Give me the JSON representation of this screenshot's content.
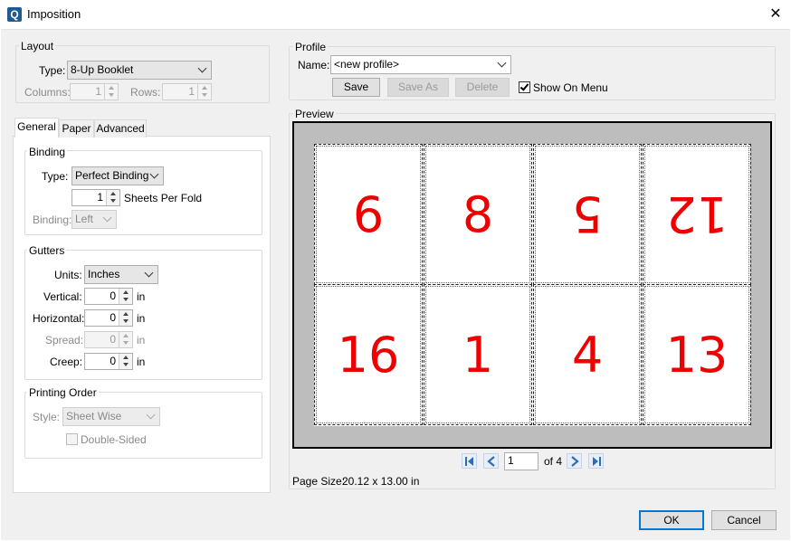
{
  "window": {
    "title": "Imposition",
    "app_icon_letter": "Q",
    "close_glyph": "✕"
  },
  "layout": {
    "legend": "Layout",
    "type_label": "Type:",
    "type_value": "8-Up Booklet",
    "columns_label": "Columns:",
    "columns_value": "1",
    "rows_label": "Rows:",
    "rows_value": "1"
  },
  "tabs": [
    {
      "label": "General",
      "active": true
    },
    {
      "label": "Paper",
      "active": false
    },
    {
      "label": "Advanced",
      "active": false
    }
  ],
  "binding": {
    "legend": "Binding",
    "type_label": "Type:",
    "type_value": "Perfect Binding",
    "sheets_value": "1",
    "sheets_label": "Sheets Per Fold",
    "binding_label": "Binding:",
    "binding_value": "Left"
  },
  "gutters": {
    "legend": "Gutters",
    "units_label": "Units:",
    "units_value": "Inches",
    "vertical_label": "Vertical:",
    "vertical_value": "0",
    "horizontal_label": "Horizontal:",
    "horizontal_value": "0",
    "spread_label": "Spread:",
    "spread_value": "0",
    "creep_label": "Creep:",
    "creep_value": "0",
    "unit_suffix": "in"
  },
  "printing_order": {
    "legend": "Printing Order",
    "style_label": "Style:",
    "style_value": "Sheet Wise",
    "double_sided_label": "Double-Sided"
  },
  "profile": {
    "legend": "Profile",
    "name_label": "Name:",
    "name_value": "<new profile>",
    "save_label": "Save",
    "save_as_label": "Save As",
    "delete_label": "Delete",
    "show_on_menu_label": "Show On Menu",
    "show_on_menu_checked": true
  },
  "preview": {
    "legend": "Preview",
    "pages_top": [
      {
        "number": "6",
        "flipped": false
      },
      {
        "number": "8",
        "flipped": false
      },
      {
        "number": "5",
        "flipped": true
      },
      {
        "number": "12",
        "flipped": true
      }
    ],
    "pages_bottom": [
      {
        "number": "16",
        "flipped": false
      },
      {
        "number": "1",
        "flipped": false
      },
      {
        "number": "4",
        "flipped": false
      },
      {
        "number": "13",
        "flipped": false
      }
    ],
    "current_page": "1",
    "of_label": "of 4",
    "page_size_label": "Page Size:",
    "page_size_value": "20.12 x 13.00 in",
    "page_color": "#ee0000"
  },
  "footer": {
    "ok_label": "OK",
    "cancel_label": "Cancel"
  }
}
